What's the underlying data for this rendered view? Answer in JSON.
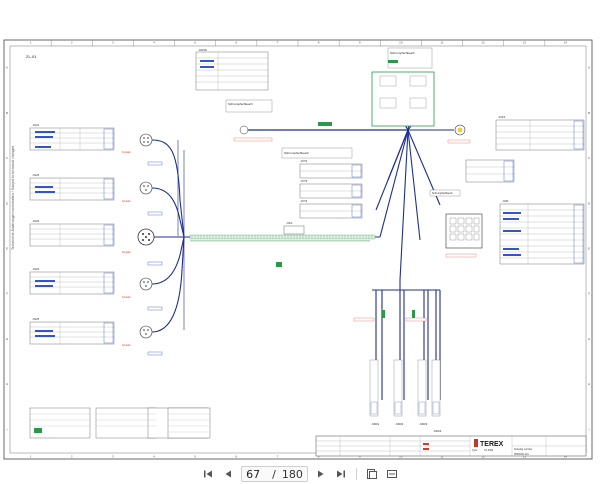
{
  "sheet": {
    "header_label": "ZL-01",
    "sidebar_note": "Technische Änderungen vorbehalten / Subject to technical changes",
    "col_numbers": [
      "1",
      "2",
      "3",
      "4",
      "5",
      "6",
      "7",
      "8",
      "9",
      "10",
      "11",
      "12",
      "13",
      "14"
    ],
    "row_letters": [
      "A",
      "B",
      "C",
      "D",
      "E",
      "F",
      "G",
      "H",
      "I"
    ],
    "connectors": {
      "top": "-X2/16",
      "x1": "-X2/1",
      "x2": "-X2/2",
      "x3": "-X2/3",
      "x4": "-X2/4",
      "x5": "-X2/5",
      "center": "-X10",
      "right_box": "-X20",
      "right_top": "-K3/1",
      "mid1": "-X7/2",
      "mid2": "-X7/3",
      "mid3": "-X7/4"
    },
    "bottom_plugs": [
      "-X30/1",
      "-X30/2",
      "-X30/3",
      "-X30/4"
    ],
    "note_top_mid": "Schrumpfschlauch",
    "note_upper_right": "Schrumpfschlauch",
    "note_mid": "Schrumpfschlauch",
    "note_box_right": "Schrumpfschlauch",
    "label_red": "Kontakt",
    "title_block": {
      "brand": "TEREX",
      "type_label": "Type",
      "type_value": "TA 4000",
      "drawing_label": "Drawing number",
      "drawing_value": "0000000-114"
    }
  },
  "toolbar": {
    "first_icon": "first-page-icon",
    "prev_icon": "previous-page-icon",
    "page_current": "67",
    "page_separator": "/",
    "page_total": "180",
    "next_icon": "next-page-icon",
    "last_icon": "last-page-icon",
    "fit_page_icon": "fit-page-icon",
    "fit_width_icon": "fit-width-icon"
  },
  "colors": {
    "wire_blue": "#1e2f8f",
    "frame": "#444444",
    "label_blue": "#3355cc",
    "accent_red": "#d83a2a",
    "accent_green": "#2a9a4a",
    "text_dark": "#222222"
  }
}
